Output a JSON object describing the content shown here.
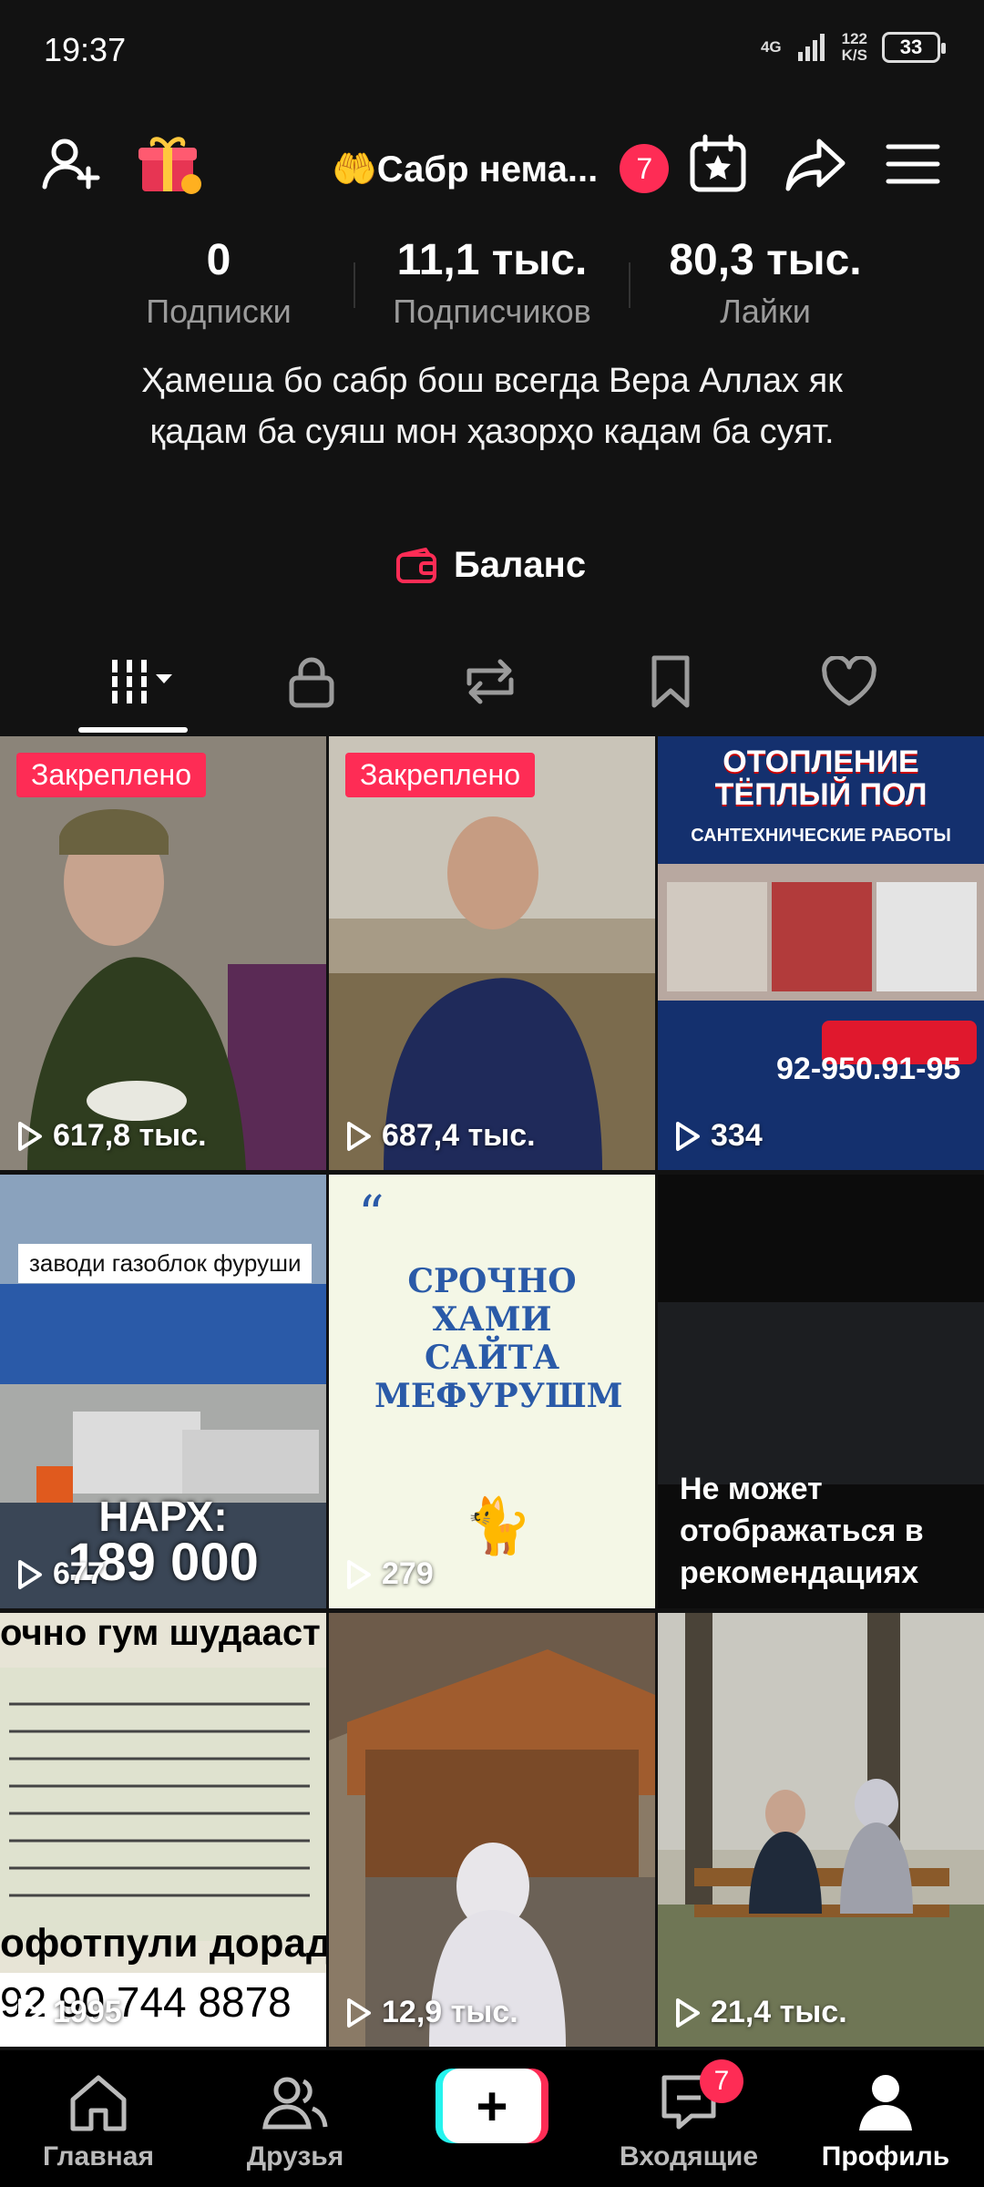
{
  "status": {
    "time": "19:37",
    "network": "4G",
    "speed_value": "122",
    "speed_unit": "K/S",
    "battery": "33"
  },
  "header": {
    "display_name": "🤲Сабр нема...",
    "notification_count": "7"
  },
  "stats": [
    {
      "value": "0",
      "label": "Подписки"
    },
    {
      "value": "11,1 тыс.",
      "label": "Подписчиков"
    },
    {
      "value": "80,3 тыс.",
      "label": "Лайки"
    }
  ],
  "bio": "Ҳамеша бо сабр бош всегда Вера Аллах як қадам ба суяш мон ҳазорҳо кадам ба суят.",
  "balance_label": "Баланс",
  "videos": [
    {
      "pinned": "Закреплено",
      "views": "617,8 тыс.",
      "bg": "#6b5a4a"
    },
    {
      "pinned": "Закреплено",
      "views": "687,4 тыс.",
      "bg": "#5a5448"
    },
    {
      "views": "334",
      "overlay_title": "ОТОПЛЕНИЕ ТЁПЛЫЙ ПОЛ",
      "overlay_sub": "САНТЕХНИЧЕСКИЕ РАБОТЫ",
      "overlay_phone": "92-950.91-95",
      "bg": "#14306e"
    },
    {
      "views": "677",
      "overlay_caption": "заводи газоблок фуруши",
      "overlay_price_label": "НАРХ:",
      "overlay_price": "189 000",
      "bg": "#5b6f86"
    },
    {
      "views": "279",
      "overlay_text": "СРОЧНО ХАМИ САЙТА МЕФУРУШМ",
      "bg": "#f4f7e6"
    },
    {
      "notice": "Не может отображаться в рекомендациях",
      "bg": "#0c0c0c"
    },
    {
      "views": "1995",
      "overlay_top": "очно гум шудааст",
      "overlay_bottom": "офотпули дорад",
      "overlay_phone": "92 90 744 8878",
      "bg": "#e9e6dc"
    },
    {
      "views": "12,9 тыс.",
      "bg": "#7a6a58"
    },
    {
      "views": "21,4 тыс.",
      "bg": "#6c7260"
    }
  ],
  "nav": {
    "home": "Главная",
    "friends": "Друзья",
    "inbox": "Входящие",
    "inbox_badge": "7",
    "profile": "Профиль"
  }
}
